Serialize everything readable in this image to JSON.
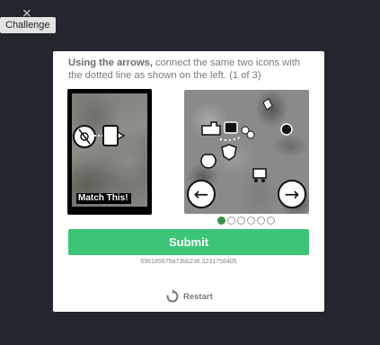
{
  "tooltip": {
    "label": "Challenge"
  },
  "close_glyph": "⨯",
  "challenge": {
    "instructions_bold": "Using the arrows,",
    "instructions_rest": "connect the same two icons with the dotted line as shown on the left. (1 of 3)",
    "match_label": "Match This!",
    "left_arrow": "←",
    "right_arrow": "→",
    "pagination": {
      "total": 6,
      "active_index": 0
    },
    "submit_label": "Submit",
    "session_id": "696185675a73bb236.3231756405",
    "restart_label": "Restart"
  },
  "colors": {
    "background": "#23262d",
    "submit": "#3cc477",
    "active_dot": "#3b8f4a"
  },
  "icons": {
    "close": "close-icon",
    "left_arrow": "left-arrow-icon",
    "right_arrow": "right-arrow-icon",
    "restart": "restart-icon",
    "target_pair": [
      "disc-icon",
      "pointer-tag-icon"
    ]
  }
}
